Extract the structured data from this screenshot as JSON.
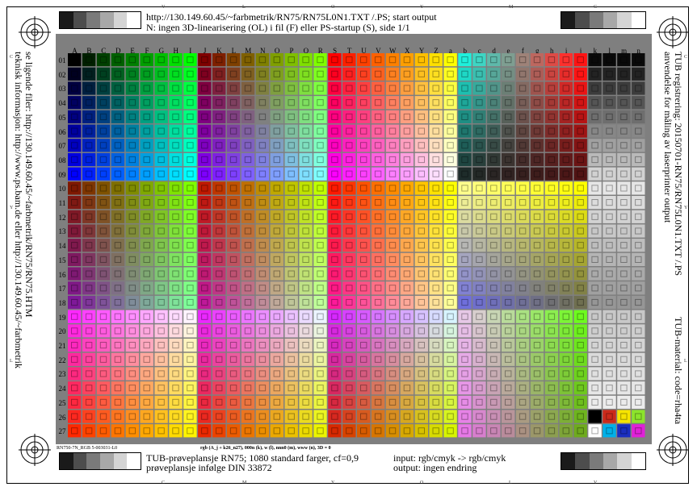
{
  "header": {
    "line1": "http://130.149.60.45/~farbmetrik/RN75/RN75L0N1.TXT /.PS; start output",
    "line2": "N: ingen 3D-linearisering (OL) i fil (F) eller PS-startup (S), side 1/1"
  },
  "left_side": {
    "line1": "se ligende filer: http://130.149.60.45/~farbmetrik/RN75/RN75.HTM",
    "line2": "teknisk informasjon: http://www.ps.bam.de eller http://130.149.60.45/~farbmetrik"
  },
  "right_side": {
    "line1": "TUB registrering: 20150701-RN75/RN75L0N1.TXT /.PS",
    "line2": "anvendelse for måling av laserprinter output",
    "material": "TUB-material: code=rha4ta"
  },
  "footer": {
    "small_left": "RN750-7N_RGB    5-003031-L0",
    "small_mid": "rgb (A_j + k26_n27), 000n (k), w (l), nnn0 (m), www (n), 3D = 0",
    "line1_left": "TUB-prøveplansje RN75; 1080 standard farger, cf=0,9",
    "line2_left": "prøveplansje infølge DIN 33872",
    "line1_right": "input: rgb/cmyk -> rgb/cmyk",
    "line2_right": "output: ingen endring"
  },
  "column_labels": [
    "A",
    "B",
    "C",
    "D",
    "E",
    "F",
    "G",
    "H",
    "I",
    "J",
    "K",
    "L",
    "M",
    "N",
    "O",
    "P",
    "Q",
    "R",
    "S",
    "T",
    "U",
    "V",
    "W",
    "X",
    "Y",
    "Z",
    "a",
    "b",
    "c",
    "d",
    "e",
    "f",
    "g",
    "h",
    "i",
    "j",
    "k",
    "l",
    "m",
    "n"
  ],
  "row_labels": [
    "01",
    "02",
    "03",
    "04",
    "05",
    "06",
    "07",
    "08",
    "09",
    "10",
    "11",
    "12",
    "13",
    "14",
    "15",
    "16",
    "17",
    "18",
    "19",
    "20",
    "21",
    "22",
    "23",
    "24",
    "25",
    "26",
    "27"
  ],
  "edge_letters": {
    "top": [
      "V",
      "L",
      "O",
      "Y",
      "M",
      "C"
    ],
    "left": [
      "C",
      "Y",
      "L"
    ],
    "right": [
      "C",
      "Y",
      "L"
    ],
    "bottom": [
      "C",
      "M",
      "Y",
      "O",
      "L",
      "V"
    ]
  },
  "colors": {
    "grey_steps": [
      "#1a1a1a",
      "#4d4d4d",
      "#7a7a7a",
      "#a8a8a8",
      "#d4d4d4",
      "#ffffff"
    ],
    "panel": "#7f7f7f"
  }
}
